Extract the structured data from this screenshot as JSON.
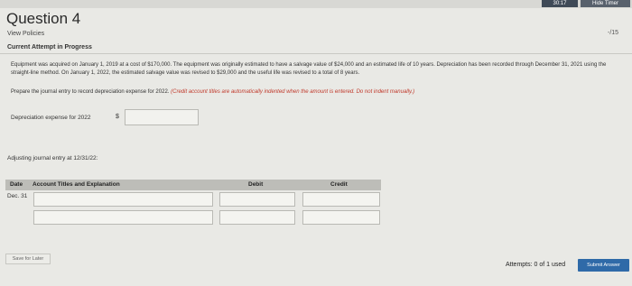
{
  "header": {
    "timer": "30:17",
    "hide_timer_label": "Hide Timer"
  },
  "question": {
    "title": "Question 4",
    "view_policies": "View Policies",
    "points": "-/15",
    "attempt_status": "Current Attempt in Progress",
    "description": "Equipment was acquired on January 1, 2019 at a cost of $170,000. The equipment was originally estimated to have a salvage value of $24,000 and an estimated life of 10 years. Depreciation has been recorded through December 31, 2021 using the straight-line method. On January 1, 2022, the estimated salvage value was revised to $29,000 and the useful life was revised to a total of 8 years.",
    "instruction": "Prepare the journal entry to record depreciation expense for 2022.",
    "instruction_note": "(Credit account titles are automatically indented when the amount is entered. Do not indent manually.)",
    "depreciation_label": "Depreciation expense for 2022",
    "currency_symbol": "$",
    "depreciation_value": ""
  },
  "journal": {
    "label": "Adjusting journal entry at 12/31/22:",
    "columns": {
      "date": "Date",
      "account": "Account Titles and Explanation",
      "debit": "Debit",
      "credit": "Credit"
    },
    "rows": [
      {
        "date": "Dec. 31",
        "account": "",
        "debit": "",
        "credit": ""
      },
      {
        "date": "",
        "account": "",
        "debit": "",
        "credit": ""
      }
    ]
  },
  "footer": {
    "save_label": "Save for Later",
    "attempts_text": "Attempts: 0 of 1 used",
    "submit_label": "Submit Answer"
  }
}
